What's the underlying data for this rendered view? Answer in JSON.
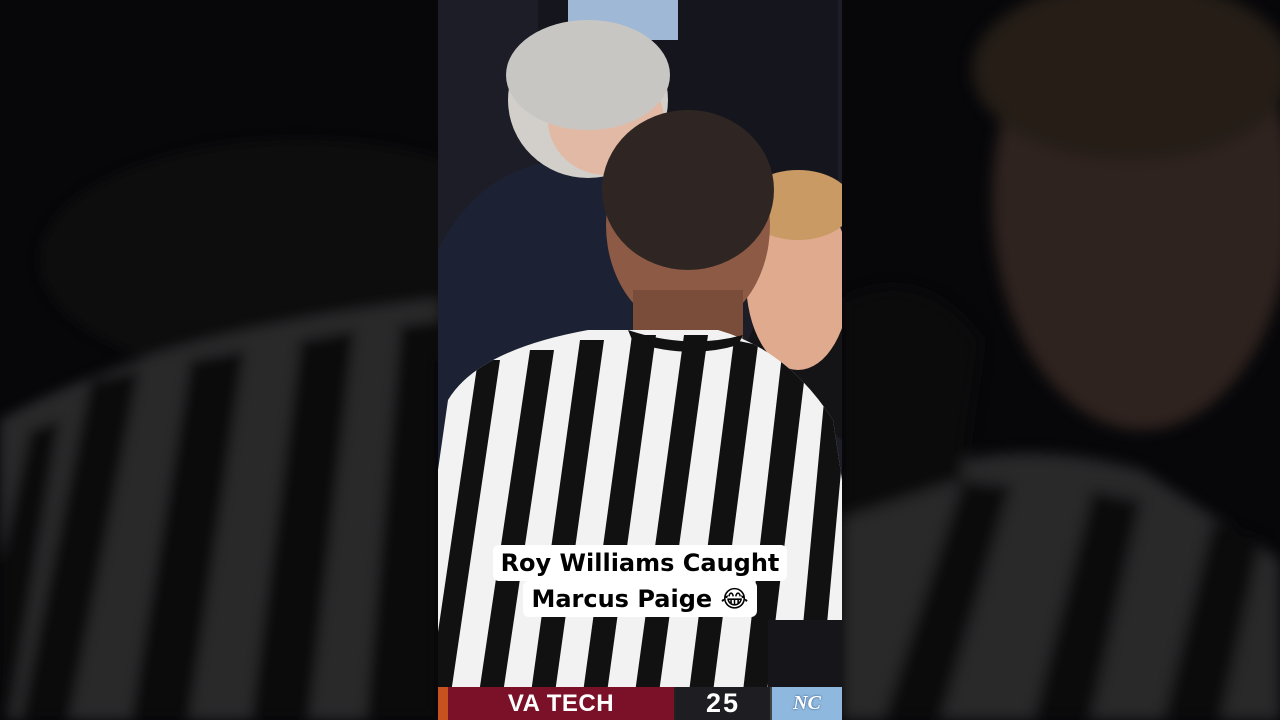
{
  "caption": {
    "line1": "Roy Williams Caught",
    "line2": "Marcus Paige 😂"
  },
  "scoreboard": {
    "team": "VA TECH",
    "score": "25",
    "opponent_logo_text": "NC"
  },
  "colors": {
    "team_bar": "#7b1128",
    "score_bar": "#1e1e22",
    "opponent_bar": "#8fb8de",
    "caption_bg": "#ffffff"
  }
}
